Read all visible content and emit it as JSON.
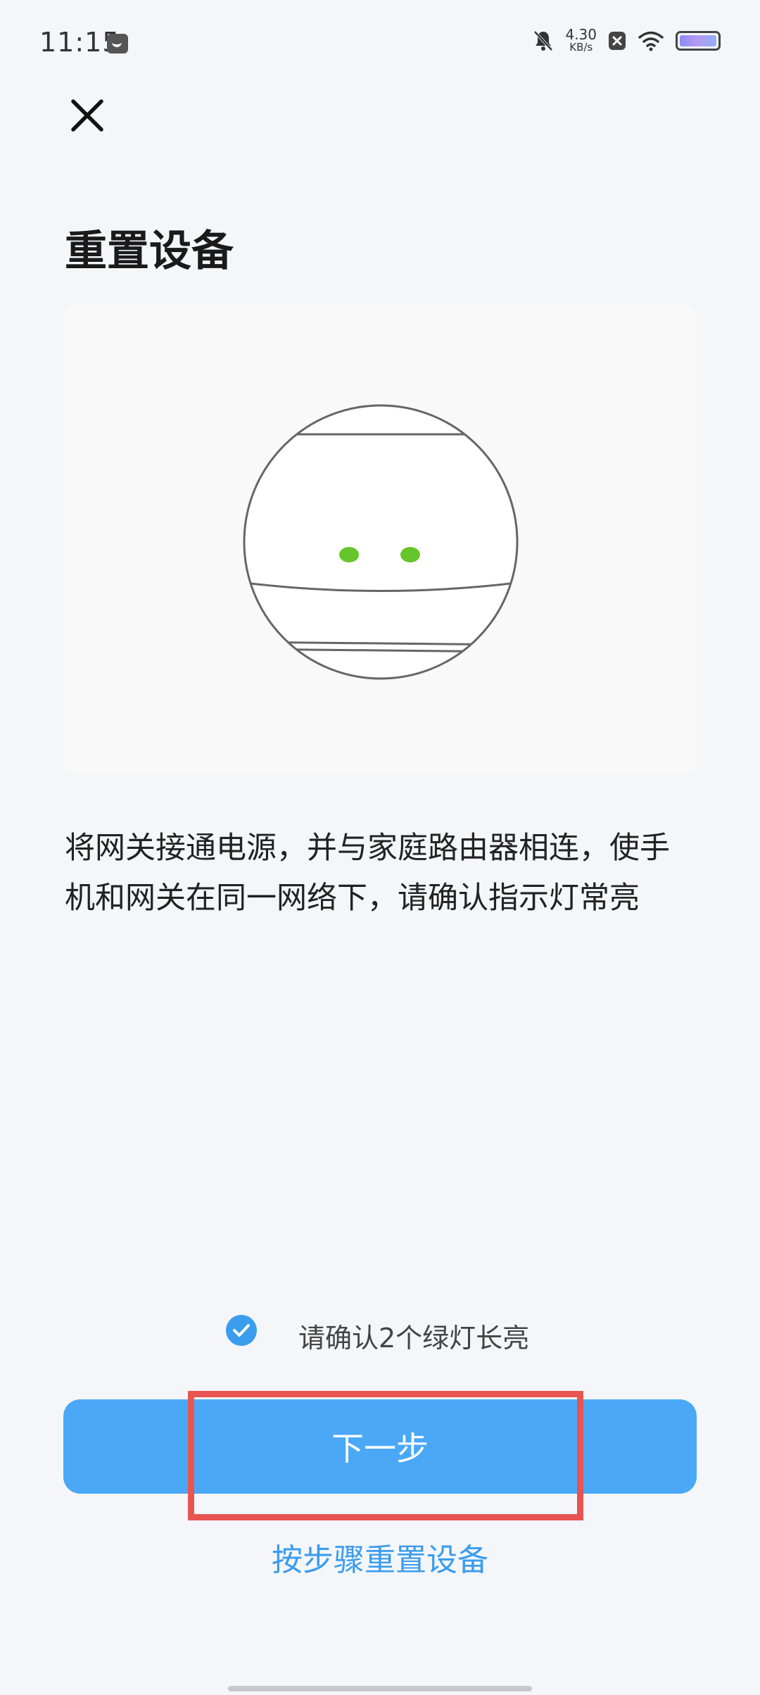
{
  "status_bar": {
    "time": "11:15",
    "net_speed_value": "4.30",
    "net_speed_unit": "KB/s",
    "icons": [
      "message-icon",
      "bell-muted-icon",
      "x-box-icon",
      "wifi-icon",
      "battery-icon"
    ]
  },
  "header": {
    "close_icon": "close-icon",
    "title": "重置设备"
  },
  "illustration": {
    "description": "gateway-device-with-two-green-lights",
    "light_color": "#66c52a"
  },
  "main": {
    "description": "将网关接通电源，并与家庭路由器相连，使手机和网关在同一网络下，请确认指示灯常亮"
  },
  "confirm": {
    "checked": true,
    "text": "请确认2个绿灯长亮"
  },
  "actions": {
    "next_label": "下一步",
    "link_label": "按步骤重置设备"
  },
  "colors": {
    "accent": "#4aa8f7",
    "link": "#3a9dee",
    "highlight": "#e85450",
    "background": "#f5f6fa"
  }
}
